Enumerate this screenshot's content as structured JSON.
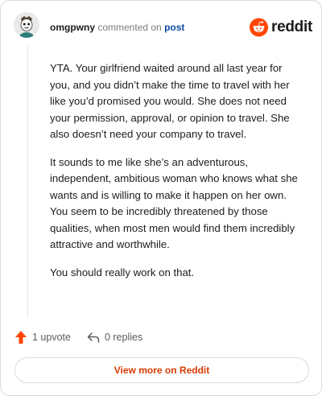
{
  "header": {
    "username": "omgpwny",
    "action_text": "commented on",
    "post_link": "post",
    "brand": "reddit"
  },
  "comment": {
    "paragraphs": [
      "YTA. Your girlfriend waited around all last year for you, and you didn’t make the time to travel with her like you’d promised you would. She does not need your permission, approval, or opinion to travel. She also doesn’t need your company to travel.",
      "It sounds to me like she’s an adventurous, independent, ambitious woman who knows what she wants and is willing to make it happen on her own. You seem to be incredibly threatened by those qualities, when most men would find them incredibly attractive and worthwhile.",
      "You should really work on that."
    ]
  },
  "actions": {
    "upvote_label": "1 upvote",
    "replies_label": "0 replies"
  },
  "footer": {
    "view_more_label": "View more on Reddit"
  },
  "colors": {
    "brand_orange": "#ff4500",
    "link_blue": "#0e4ba8",
    "view_more_text": "#d93a00"
  },
  "icons": [
    "avatar",
    "reddit-logo-icon",
    "upvote-arrow-icon",
    "reply-arrow-icon"
  ]
}
